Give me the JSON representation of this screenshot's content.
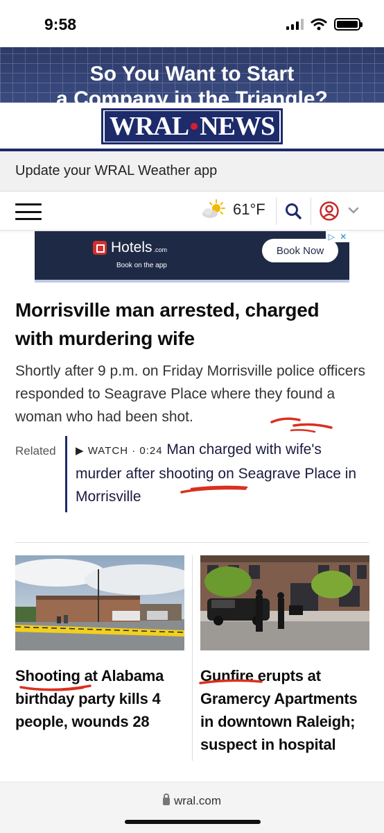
{
  "status_bar": {
    "time": "9:58"
  },
  "top_ad": {
    "line1": "So You Want to Start",
    "line2": "a Company in the Triangle?"
  },
  "header": {
    "logo_left": "WRAL",
    "logo_right": "NEWS"
  },
  "update_bar": {
    "text": "Update your WRAL Weather app"
  },
  "nav": {
    "weather_icon": "partly-sunny-icon",
    "temperature": "61°F"
  },
  "hotels_ad": {
    "brand": "Hotels",
    "brand_suffix": ".com",
    "tagline": "Book on the app",
    "cta": "Book Now"
  },
  "main_story": {
    "headline": "Morrisville man arrested, charged with murdering wife",
    "summary": "Shortly after 9 p.m. on Friday Morrisville police officers responded to Seagrave Place where they found a woman who had been shot.",
    "related_label": "Related",
    "related_tag": "▶ WATCH · 0:24",
    "related_title": "Man charged with wife's murder after shooting on Seagrave Place in Morrisville"
  },
  "cards": [
    {
      "title": "Shooting at Alabama birthday party kills 4 people, wounds 28"
    },
    {
      "title": "Gunfire erupts at Gramercy Apartments in downtown Raleigh; suspect in hospital"
    }
  ],
  "url_bar": {
    "domain": "wral.com"
  },
  "colors": {
    "brand_navy": "#1d2b6b",
    "brand_red": "#d4202e",
    "annotation_red": "#d9301f"
  }
}
